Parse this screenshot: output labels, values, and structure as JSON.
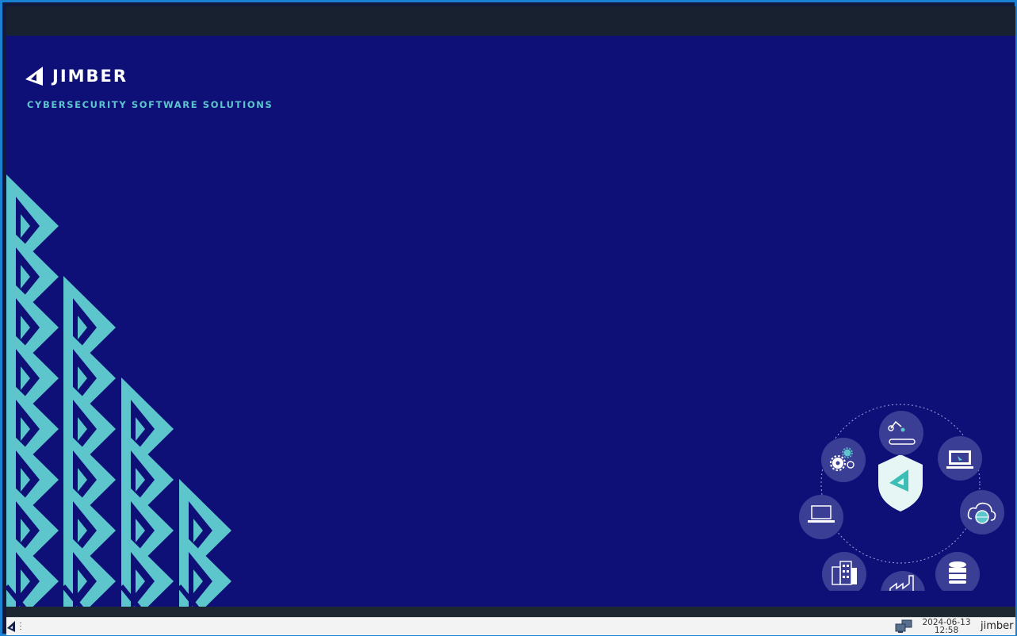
{
  "brand": {
    "name": "JIMBER",
    "tagline": "CYBERSECURITY SOFTWARE SOLUTIONS"
  },
  "colors": {
    "desktop_bg": "#0f0f78",
    "accent_teal": "#5cc6cc",
    "topbar": "#17212f",
    "window_border": "#1b81d3",
    "hub_circle": "#3b3e95"
  },
  "hub_icons": [
    "robot-arm-conveyor-icon",
    "laptop-screen-icon",
    "cloud-globe-icon",
    "database-icon",
    "factory-icon",
    "office-building-icon",
    "laptop-icon",
    "gears-icon",
    "shield-logo-icon"
  ],
  "taskbar": {
    "date": "2024-06-13",
    "time": "12:58",
    "user": "jimber",
    "icons": [
      "jimber-menu-icon",
      "handle-icon",
      "network-icon"
    ]
  }
}
